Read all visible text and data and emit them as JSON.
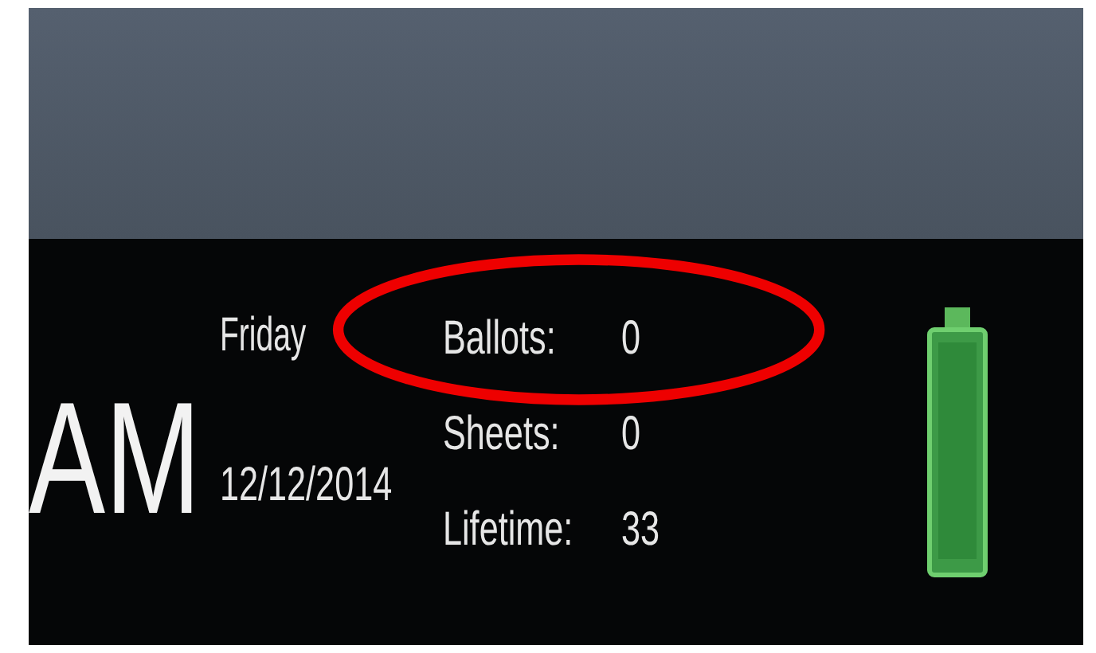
{
  "status_bar": {
    "time_suffix": "AM",
    "day": "Friday",
    "date": "12/12/2014",
    "counters": [
      {
        "label": "Ballots:",
        "value": "0"
      },
      {
        "label": "Sheets:",
        "value": "0"
      },
      {
        "label": "Lifetime:",
        "value": "33"
      }
    ]
  }
}
